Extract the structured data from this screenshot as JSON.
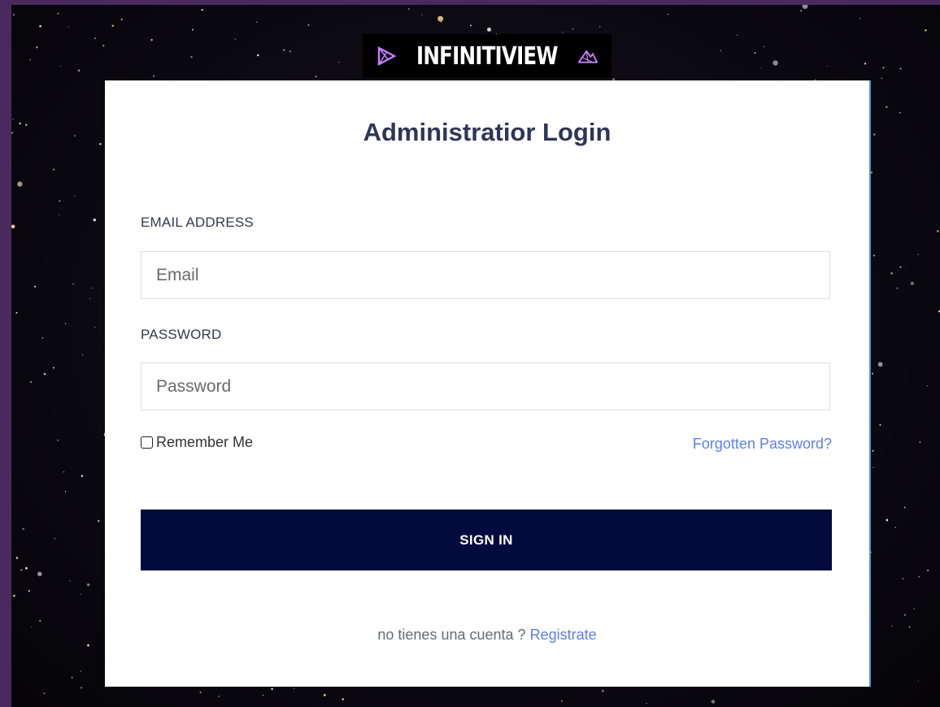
{
  "logo": {
    "text": "INFINITIVIEW",
    "icon_left": "triangle-logo-icon",
    "icon_right": "mountain-logo-icon",
    "accent_color": "#c77dff"
  },
  "login": {
    "title": "Administratior Login",
    "email_label": "EMAIL ADDRESS",
    "email_placeholder": "Email",
    "email_value": "",
    "password_label": "PASSWORD",
    "password_placeholder": "Password",
    "password_value": "",
    "remember_label": "Remember Me",
    "remember_checked": false,
    "forgot_label": "Forgotten Password?",
    "signin_label": "SIGN IN",
    "register_prompt": "no tienes una cuenta ?",
    "register_link": "Registrate"
  },
  "colors": {
    "page_border": "#4a2a5e",
    "button_bg": "#020a3e",
    "link": "#5b7fe8",
    "title": "#2f3558"
  }
}
